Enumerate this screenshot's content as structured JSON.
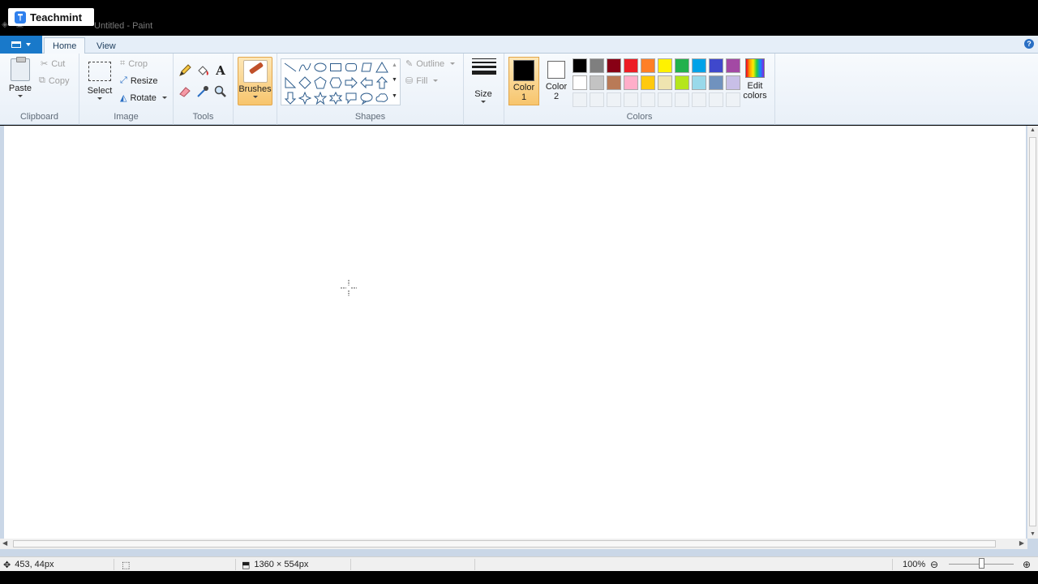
{
  "overlay": {
    "brand": "Teachmint"
  },
  "window": {
    "title": "Untitled - Paint"
  },
  "tabs": [
    {
      "label": "Home"
    },
    {
      "label": "View"
    }
  ],
  "ribbon": {
    "clipboard": {
      "label": "Clipboard",
      "paste": "Paste",
      "cut": "Cut",
      "copy": "Copy"
    },
    "image": {
      "label": "Image",
      "select": "Select",
      "crop": "Crop",
      "resize": "Resize",
      "rotate": "Rotate"
    },
    "tools": {
      "label": "Tools"
    },
    "brushes": {
      "label": "Brushes"
    },
    "shapes": {
      "label": "Shapes",
      "outline": "Outline",
      "fill": "Fill"
    },
    "size": {
      "label": "Size"
    },
    "colors": {
      "label": "Colors",
      "color1_line1": "Color",
      "color1_line2": "1",
      "color2_line1": "Color",
      "color2_line2": "2",
      "edit_line1": "Edit",
      "edit_line2": "colors",
      "color1_value": "#000000",
      "color2_value": "#ffffff",
      "palette": [
        "#000000",
        "#7f7f7f",
        "#880015",
        "#ed1c24",
        "#ff7f27",
        "#fff200",
        "#22b14c",
        "#00a2e8",
        "#3f48cc",
        "#a349a4",
        "#ffffff",
        "#c3c3c3",
        "#b97a57",
        "#ffaec9",
        "#ffc90e",
        "#efe4b0",
        "#b5e61d",
        "#99d9ea",
        "#7092be",
        "#c8bfe7"
      ]
    }
  },
  "status": {
    "cursor_pos": "453, 44px",
    "canvas_size": "1360 × 554px",
    "zoom": "100%"
  }
}
